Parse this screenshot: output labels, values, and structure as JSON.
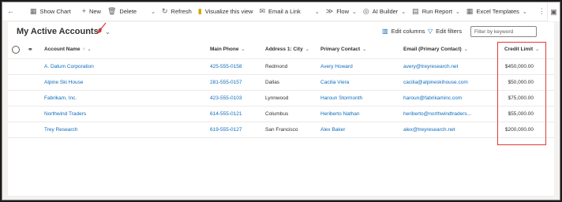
{
  "commandbar": {
    "items": [
      {
        "icon": "chart-icon",
        "label": "Show Chart"
      },
      {
        "icon": "plus-icon",
        "label": "New"
      },
      {
        "icon": "trash-icon",
        "label": "Delete"
      },
      {
        "icon": "refresh-icon",
        "label": "Refresh"
      },
      {
        "icon": "visualize-icon",
        "label": "Visualize this view"
      },
      {
        "icon": "email-icon",
        "label": "Email a Link"
      },
      {
        "icon": "flow-icon",
        "label": "Flow"
      },
      {
        "icon": "ai-builder-icon",
        "label": "AI Builder"
      },
      {
        "icon": "report-icon",
        "label": "Run Report"
      },
      {
        "icon": "excel-icon",
        "label": "Excel Templates"
      }
    ]
  },
  "view": {
    "title": "My Active Accounts",
    "modified_marker": "*",
    "edit_columns": "Edit columns",
    "edit_filters": "Edit filters",
    "filter_placeholder": "Filter by keyword"
  },
  "grid": {
    "columns": {
      "account_name": "Account Name",
      "account_name_sort": "↑",
      "main_phone": "Main Phone",
      "city": "Address 1: City",
      "primary_contact": "Primary Contact",
      "email": "Email (Primary Contact)",
      "credit_limit": "Credit Limit"
    },
    "rows": [
      {
        "name": "A. Datum Corporation",
        "phone": "425-555-0158",
        "city": "Redmond",
        "contact": "Avery Howard",
        "email": "avery@treyresearch.net",
        "credit": "$450,000.00"
      },
      {
        "name": "Alpine Ski House",
        "phone": "281-555-0157",
        "city": "Dallas",
        "contact": "Cacilia Viera",
        "email": "cacilia@alpineskihouse.com",
        "credit": "$50,000.00"
      },
      {
        "name": "Fabrikam, Inc.",
        "phone": "423-555-0103",
        "city": "Lynnwood",
        "contact": "Haroun Stormonth",
        "email": "haroun@fabrikaminc.com",
        "credit": "$75,000.00"
      },
      {
        "name": "Northwind Traders",
        "phone": "614-555-0121",
        "city": "Columbus",
        "contact": "Heriberto Nathan",
        "email": "heriberto@northwindtraders...",
        "credit": "$55,000.00"
      },
      {
        "name": "Trey Research",
        "phone": "619-555-0127",
        "city": "San Francisco",
        "contact": "Alex Baker",
        "email": "alex@treyresearch.net",
        "credit": "$200,000.00"
      }
    ]
  },
  "colors": {
    "link": "#0f6cbd",
    "highlight": "#e03a3a"
  }
}
